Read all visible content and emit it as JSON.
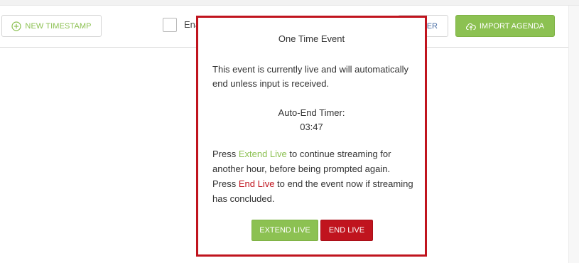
{
  "toolbar": {
    "new_timestamp_label": "NEW TIMESTAMP",
    "checkbox_label": "Ena",
    "partial_button_label": "ER",
    "import_agenda_label": "IMPORT AGENDA"
  },
  "icons": {
    "new_timestamp": "plus-circle-icon",
    "import_agenda": "cloud-upload-icon"
  },
  "colors": {
    "accent_green": "#8cc152",
    "danger_red": "#c0141e"
  },
  "modal": {
    "title": "One Time Event",
    "body": "This event is currently live and will automatically end unless input is received.",
    "timer_label": "Auto-End Timer:",
    "timer_value": "03:47",
    "instr_press1": "Press ",
    "instr_extend_term": "Extend Live",
    "instr_mid": " to continue streaming for another hour, before being prompted again. Press ",
    "instr_end_term": "End Live",
    "instr_tail": " to end the event now if streaming has concluded.",
    "extend_button": "EXTEND LIVE",
    "end_button": "END LIVE"
  }
}
